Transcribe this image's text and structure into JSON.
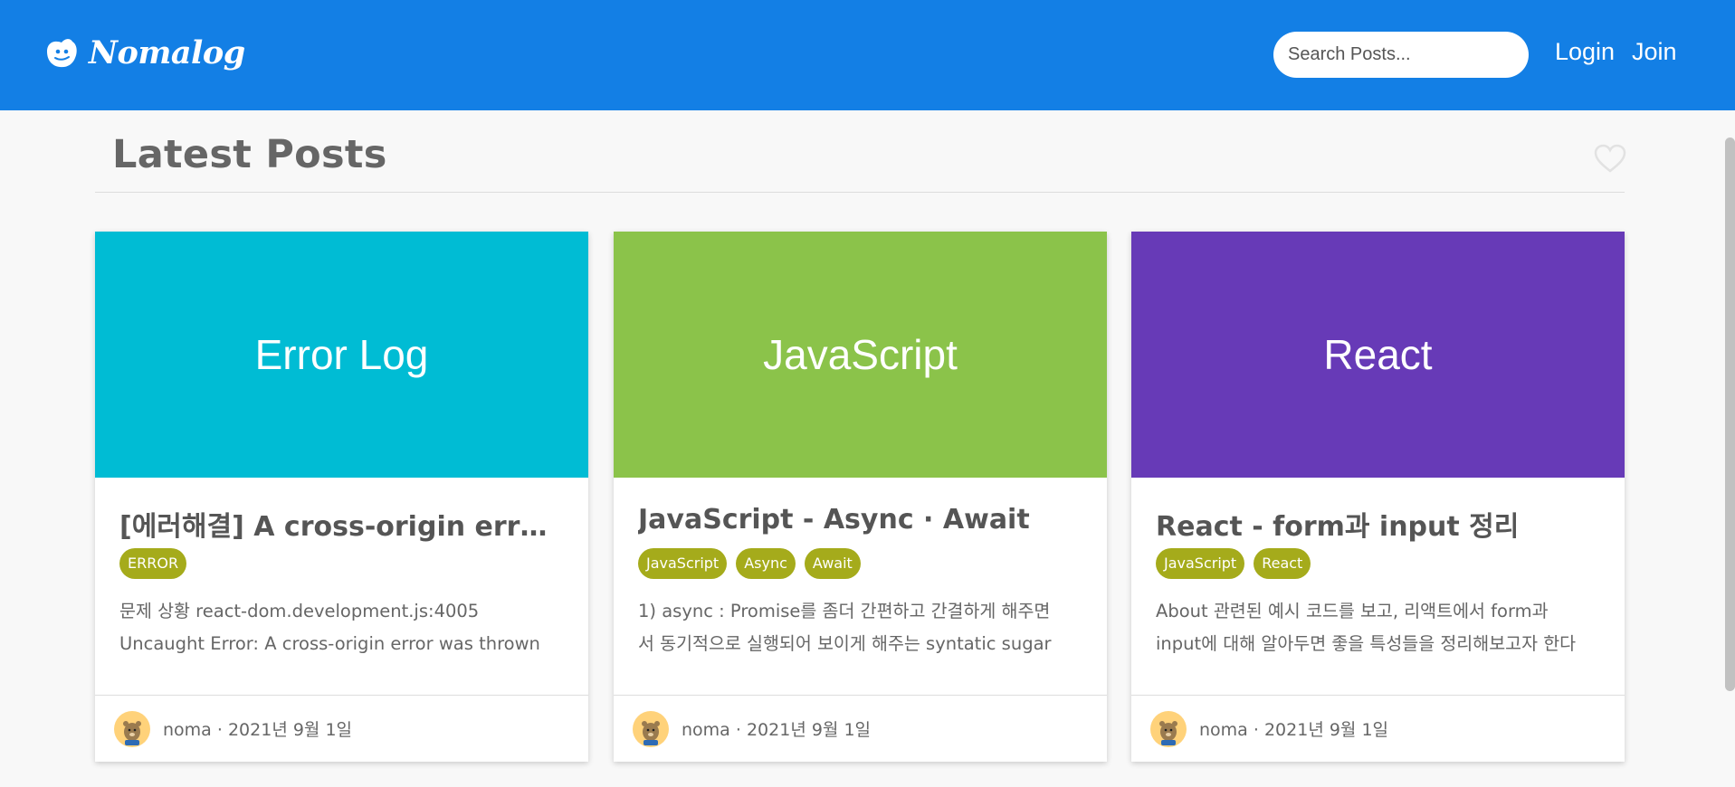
{
  "header": {
    "brand": "Nomalog",
    "search_placeholder": "Search Posts...",
    "login_label": "Login",
    "join_label": "Join",
    "background_color": "#137fe5"
  },
  "main": {
    "title": "Latest Posts",
    "favorite_icon": "heart-outline-icon"
  },
  "posts": [
    {
      "thumbnail_text": "Error Log",
      "thumbnail_color": "#00bcd4",
      "title": "[에러해결] A cross-origin error was thrown",
      "tags": [
        "ERROR"
      ],
      "excerpt_lines": [
        "문제 상황 react-dom.development.js:4005",
        "Uncaught Error: A cross-origin error was thrown"
      ],
      "author": "noma",
      "separator": "·",
      "date": "2021년 9월 1일"
    },
    {
      "thumbnail_text": "JavaScript",
      "thumbnail_color": "#8bc34a",
      "title": "JavaScript - Async · Await",
      "tags": [
        "JavaScript",
        "Async",
        "Await"
      ],
      "excerpt_lines": [
        "1) async : Promise를 좀더 간편하고 간결하게 해주면",
        "서 동기적으로 실행되어 보이게 해주는 syntatic sugar"
      ],
      "author": "noma",
      "separator": "·",
      "date": "2021년 9월 1일"
    },
    {
      "thumbnail_text": "React",
      "thumbnail_color": "#673ab7",
      "title": "React - form과 input 정리",
      "tags": [
        "JavaScript",
        "React"
      ],
      "excerpt_lines": [
        "About 관련된 예시 코드를 보고, 리액트에서 form과",
        "input에 대해 알아두면 좋을 특성들을 정리해보고자 한다"
      ],
      "author": "noma",
      "separator": "·",
      "date": "2021년 9월 1일"
    }
  ],
  "colors": {
    "tag": "#a5ab1b",
    "page_background": "#f8f8f8"
  }
}
